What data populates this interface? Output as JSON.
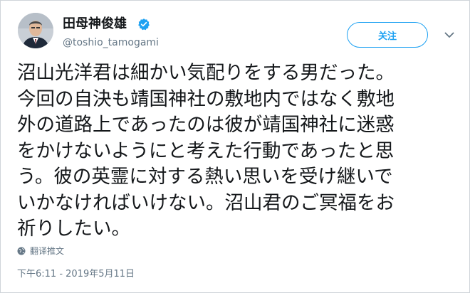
{
  "user": {
    "display_name": "田母神俊雄",
    "handle": "@toshio_tamogami",
    "verified": true,
    "verified_icon": "verified-badge-icon"
  },
  "actions": {
    "follow_label": "关注",
    "menu_icon": "chevron-down-icon"
  },
  "tweet": {
    "lines": [
      "沼山光洋君は細かい気配りをする男だった。",
      "今回の自決も靖国神社の敷地内ではなく敷地",
      "外の道路上であったのは彼が靖国神社に迷惑",
      "をかけないようにと考えた行動であったと思",
      "う。彼の英霊に対する熱い思いを受け継いで",
      "いかなければいけない。沼山君のご冥福をお",
      "祈りしたい。"
    ]
  },
  "translate": {
    "label": "翻译推文",
    "icon": "globe-icon"
  },
  "timestamp": "下午6:11 - 2019年5月11日",
  "colors": {
    "accent": "#1da1f2",
    "text": "#14171a",
    "secondary": "#657786"
  }
}
